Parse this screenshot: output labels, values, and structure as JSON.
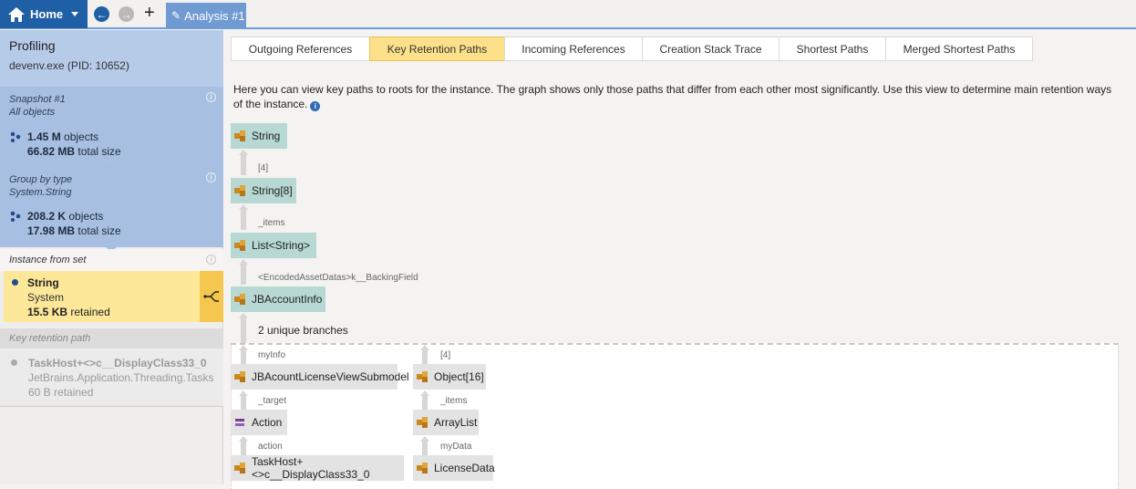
{
  "topbar": {
    "home_label": "Home",
    "analysis_tab": "Analysis #1"
  },
  "sidebar": {
    "title": "Profiling",
    "process": "devenv.exe (PID: 10652)",
    "snapshot": {
      "header": "Snapshot #1",
      "subheader": "All objects",
      "objects_count": "1.45 M",
      "objects_label": "objects",
      "size": "66.82 MB",
      "size_label": "total size"
    },
    "group": {
      "header": "Group by type",
      "subheader": "System.String",
      "objects_count": "208.2 K",
      "objects_label": "objects",
      "size": "17.98 MB",
      "size_label": "total size"
    },
    "instance": {
      "header": "Instance from set",
      "name": "String",
      "namespace": "System",
      "retained": "15.5 KB",
      "retained_label": "retained"
    },
    "key_path": {
      "header": "Key retention path",
      "name": "TaskHost+<>c__DisplayClass33_0",
      "namespace": "JetBrains.Application.Threading.Tasks",
      "retained": "60 B retained"
    }
  },
  "tabs": [
    {
      "label": "Outgoing References",
      "active": false
    },
    {
      "label": "Key Retention Paths",
      "active": true
    },
    {
      "label": "Incoming References",
      "active": false
    },
    {
      "label": "Creation Stack Trace",
      "active": false
    },
    {
      "label": "Shortest Paths",
      "active": false
    },
    {
      "label": "Merged Shortest Paths",
      "active": false
    }
  ],
  "description": "Here you can view key paths to roots for the instance. The graph shows only those paths that differ from each other most significantly. Use this view to determine main retention ways of the instance.",
  "graph": {
    "nodes": {
      "string": "String",
      "string_array": "String[8]",
      "list": "List<String>",
      "account_info": "JBAccountInfo",
      "viewsubmodel": "JBAcountLicenseViewSubmodel",
      "action": "Action",
      "taskhost": "TaskHost+<>c__DisplayClass33_0",
      "object_array": "Object[16]",
      "arraylist": "ArrayList",
      "licensedata": "LicenseData"
    },
    "edges": {
      "e1": "[4]",
      "e2": "_items",
      "e3": "<EncodedAssetDatas>k__BackingField",
      "b1_1": "myInfo",
      "b1_2": "_target",
      "b1_3": "action",
      "b2_1": "[4]",
      "b2_2": "_items",
      "b2_3": "myData"
    },
    "branches_label": "2 unique branches"
  },
  "colors": {
    "accent": "#1f5fa6",
    "sidebar_blue": "#a4bde0",
    "selected": "#fde89a",
    "node": "#b8d8d3",
    "tab_active": "#fde08a"
  }
}
